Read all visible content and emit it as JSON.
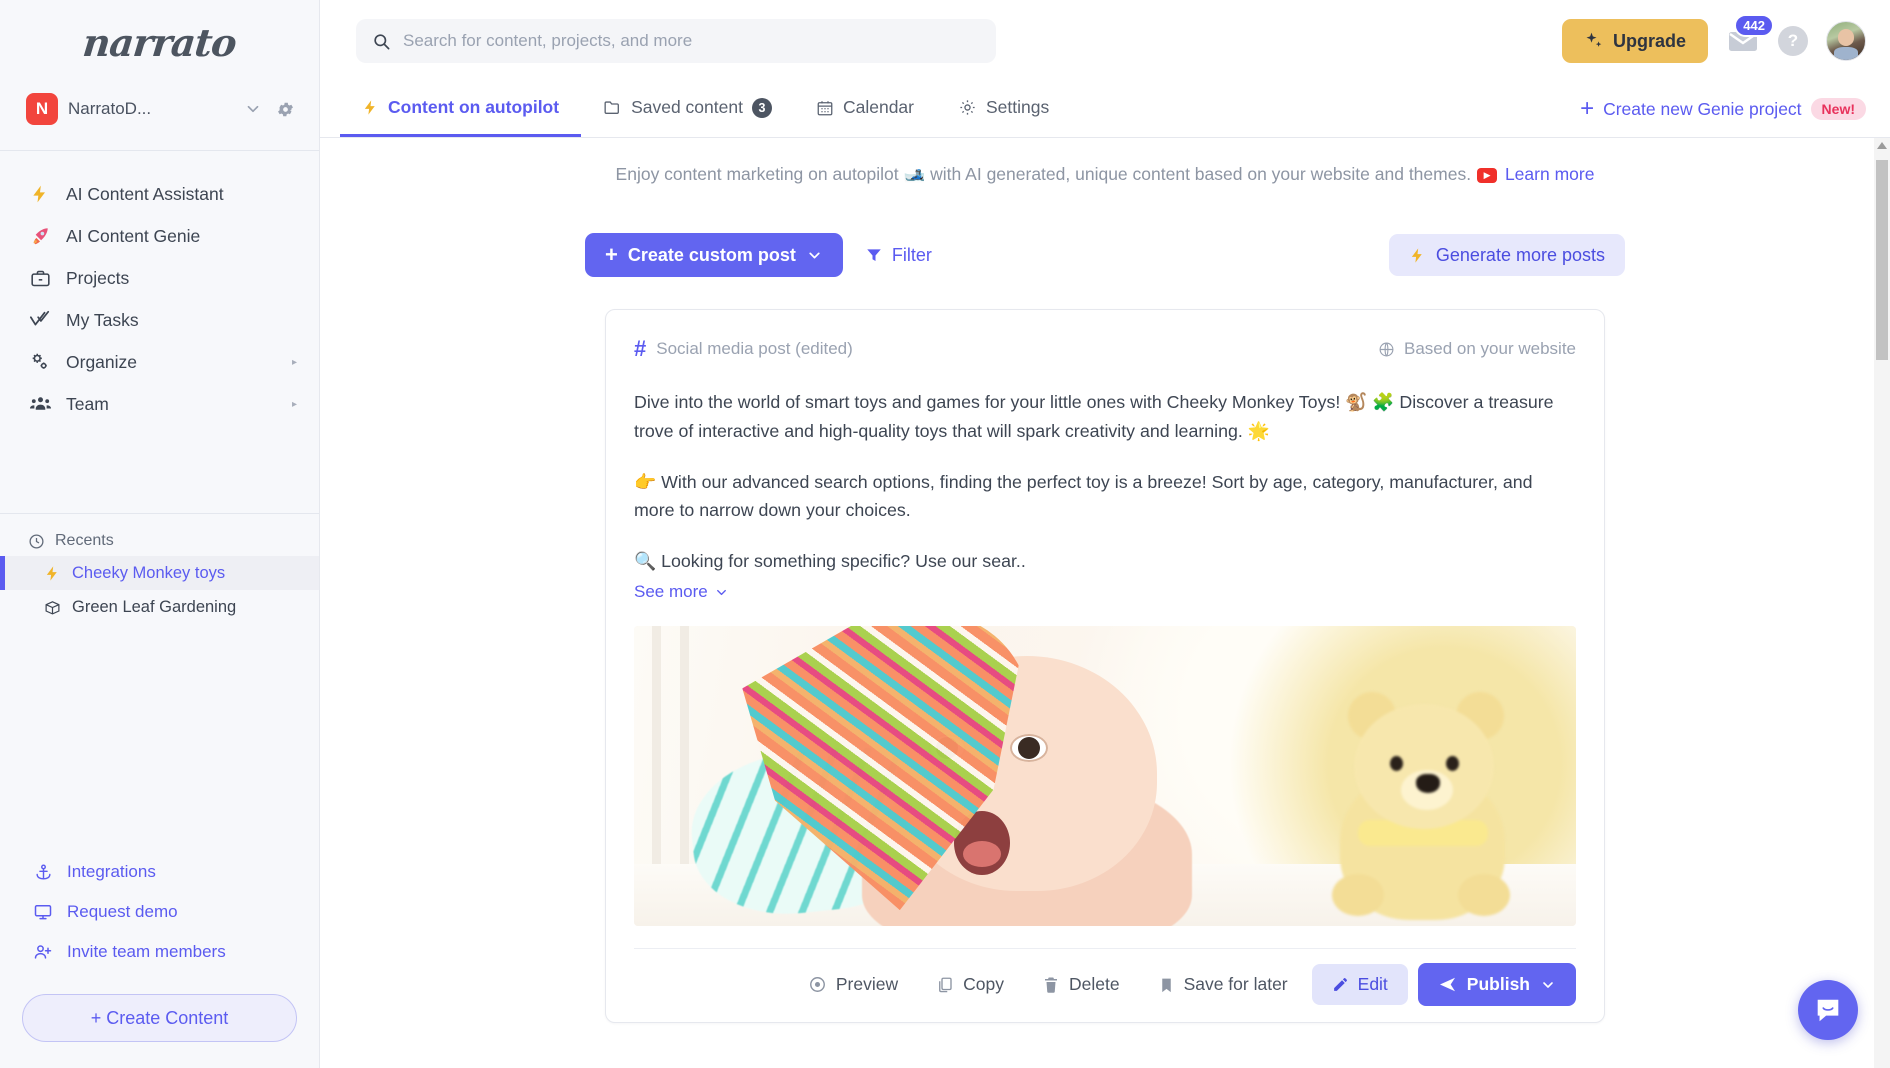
{
  "brand": {
    "logo_text": "narrato",
    "accent": "#5b5bf0",
    "upgrade_color": "#edbf5c"
  },
  "workspace": {
    "initial": "N",
    "name": "NarratoD..."
  },
  "sidebar": {
    "nav": [
      {
        "label": "AI Content Assistant",
        "icon": "lightning-icon"
      },
      {
        "label": "AI Content Genie",
        "icon": "rocket-icon"
      },
      {
        "label": "Projects",
        "icon": "briefcase-icon"
      },
      {
        "label": "My Tasks",
        "icon": "check-double-icon"
      },
      {
        "label": "Organize",
        "icon": "gears-icon",
        "arrow": "▸"
      },
      {
        "label": "Team",
        "icon": "people-icon",
        "arrow": "▸"
      }
    ],
    "recents_label": "Recents",
    "recents": [
      {
        "label": "Cheeky Monkey toys",
        "icon": "lightning-icon",
        "active": true
      },
      {
        "label": "Green Leaf Gardening",
        "icon": "box-icon",
        "active": false
      }
    ],
    "bottom_links": [
      {
        "label": "Integrations",
        "icon": "anchor-icon"
      },
      {
        "label": "Request demo",
        "icon": "monitor-icon"
      },
      {
        "label": "Invite team members",
        "icon": "user-plus-icon"
      }
    ],
    "create_content_label": "+ Create Content"
  },
  "topbar": {
    "search_placeholder": "Search for content, projects, and more",
    "search_value": "",
    "upgrade_label": "Upgrade",
    "mail_badge": "442",
    "help_label": "?"
  },
  "tabs": [
    {
      "label": "Content on autopilot",
      "icon": "lightning-icon",
      "active": true,
      "badge": ""
    },
    {
      "label": "Saved content",
      "icon": "folder-icon",
      "active": false,
      "badge": "3"
    },
    {
      "label": "Calendar",
      "icon": "calendar-icon",
      "active": false,
      "badge": ""
    },
    {
      "label": "Settings",
      "icon": "gear-icon",
      "active": false,
      "badge": ""
    }
  ],
  "genie": {
    "label": "Create new Genie project",
    "plus": "+",
    "badge": "New!"
  },
  "banner": {
    "text_before": "Enjoy content marketing on autopilot 🎿 with AI generated, unique content based on your website and themes.",
    "link": "Learn more"
  },
  "actionbar": {
    "create_post_label": "Create custom post",
    "filter_label": "Filter",
    "generate_more_label": "Generate more posts"
  },
  "post": {
    "type_label": "Social media post (edited)",
    "source_label": "Based on your website",
    "paragraphs": [
      "Dive into the world of smart toys and games for your little ones with Cheeky Monkey Toys! 🐒 🧩 Discover a treasure trove of interactive and high-quality toys that will spark creativity and learning. 🌟",
      "👉 With our advanced search options, finding the perfect toy is a breeze! Sort by age, category, manufacturer, and more to narrow down your choices.",
      "🔍 Looking for something specific? Use our sear.."
    ],
    "see_more_label": "See more",
    "image_alt": "baby-with-teddy-bear-photo",
    "actions": [
      {
        "label": "Preview",
        "icon": "eye-icon"
      },
      {
        "label": "Copy",
        "icon": "copy-icon"
      },
      {
        "label": "Delete",
        "icon": "trash-icon"
      },
      {
        "label": "Save for later",
        "icon": "bookmark-icon"
      }
    ],
    "edit_label": "Edit",
    "publish_label": "Publish"
  }
}
